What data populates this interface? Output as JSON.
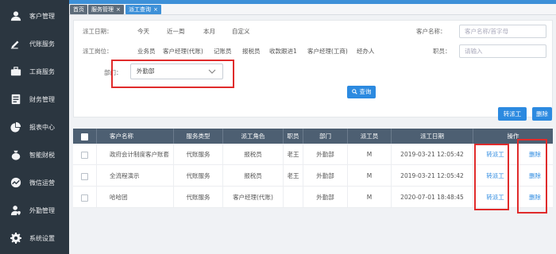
{
  "sidebar": {
    "items": [
      {
        "label": "客户管理",
        "icon": "user-icon"
      },
      {
        "label": "代账服务",
        "icon": "pen-icon"
      },
      {
        "label": "工商服务",
        "icon": "briefcase-icon"
      },
      {
        "label": "财务管理",
        "icon": "ledger-icon"
      },
      {
        "label": "报表中心",
        "icon": "pie-chart-icon"
      },
      {
        "label": "智能财税",
        "icon": "money-bag-icon"
      },
      {
        "label": "微信运营",
        "icon": "wave-icon"
      },
      {
        "label": "外勤管理",
        "icon": "person-pin-icon"
      },
      {
        "label": "系统设置",
        "icon": "gear-icon"
      }
    ]
  },
  "tabs": {
    "home": "首页",
    "business": "服务管理",
    "active": "派工查询",
    "close": "×"
  },
  "filters": {
    "date_label": "派工日期：",
    "date_options": [
      "今天",
      "近一周",
      "本月",
      "自定义"
    ],
    "role_label": "派工岗位：",
    "role_options": [
      "业务员",
      "客户经理(代账)",
      "记账员",
      "报税员",
      "收款跟进1",
      "客户经理(工商)",
      "经办人"
    ],
    "dept_label": "部门：",
    "dept_value": "外勤部",
    "customer_label": "客户名称：",
    "customer_placeholder": "客户名称/首字母",
    "staff_label": "职员：",
    "staff_placeholder": "请输入",
    "query_label": "查询"
  },
  "actions": {
    "transfer": "转派工",
    "delete": "删除"
  },
  "table": {
    "headers": [
      "客户名称",
      "服务类型",
      "派工角色",
      "职员",
      "部门",
      "派工员",
      "派工日期",
      "操作"
    ],
    "rows": [
      {
        "customer": "政府会计制度客户账套",
        "service": "代账服务",
        "role": "报税员",
        "staff": "老王",
        "dept": "外勤部",
        "dispatcher": "M",
        "date": "2019-03-21 12:05:42",
        "op1": "转派工",
        "op2": "删除"
      },
      {
        "customer": "全流程演示",
        "service": "代账服务",
        "role": "报税员",
        "staff": "老王",
        "dept": "外勤部",
        "dispatcher": "M",
        "date": "2019-03-21 12:05:42",
        "op1": "转派工",
        "op2": "删除"
      },
      {
        "customer": "哈哈团",
        "service": "代账服务",
        "role": "客户经理(代账)",
        "staff": "",
        "dept": "外勤部",
        "dispatcher": "M",
        "date": "2020-07-01 18:48:45",
        "op1": "转派工",
        "op2": "删除"
      }
    ]
  },
  "colors": {
    "sidebar": "#2b3640",
    "accent": "#2c8ae0",
    "header": "#4d5f72",
    "highlight": "#e02b2b"
  }
}
